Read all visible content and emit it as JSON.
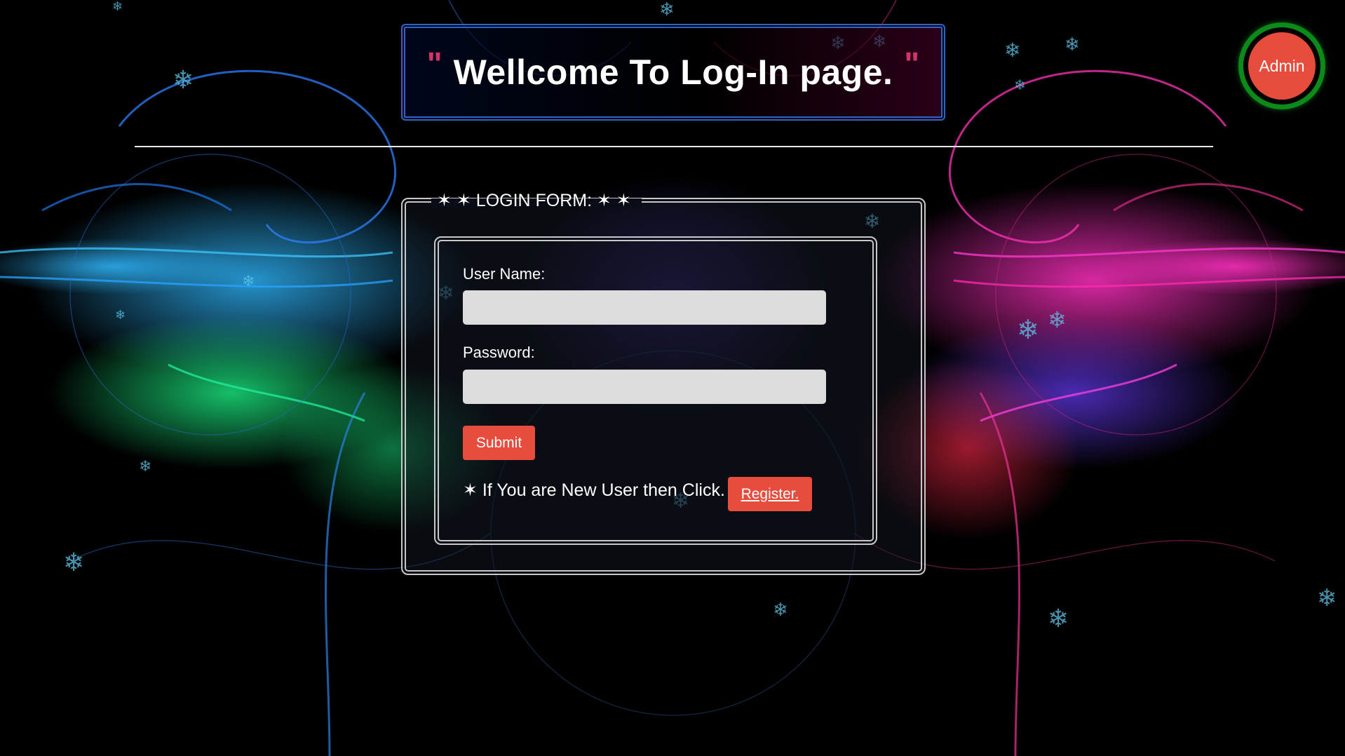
{
  "header": {
    "quote_open": "\"",
    "title": "Wellcome To Log-In page.",
    "quote_close": "\""
  },
  "admin_button": {
    "label": "Admin"
  },
  "login_form": {
    "legend": "✶ ✶ LOGIN FORM: ✶ ✶",
    "username_label": "User Name:",
    "username_value": "",
    "password_label": "Password:",
    "password_value": "",
    "submit_label": "Submit",
    "new_user_text": "✶ If You are New User then Click.",
    "register_label": "Register."
  },
  "colors": {
    "accent_red": "#e74c3c",
    "admin_ring": "#0c8a1a",
    "title_border": "#2b65c8",
    "quote_color": "#d6336c"
  },
  "icons": [
    "snowflake-icon"
  ]
}
